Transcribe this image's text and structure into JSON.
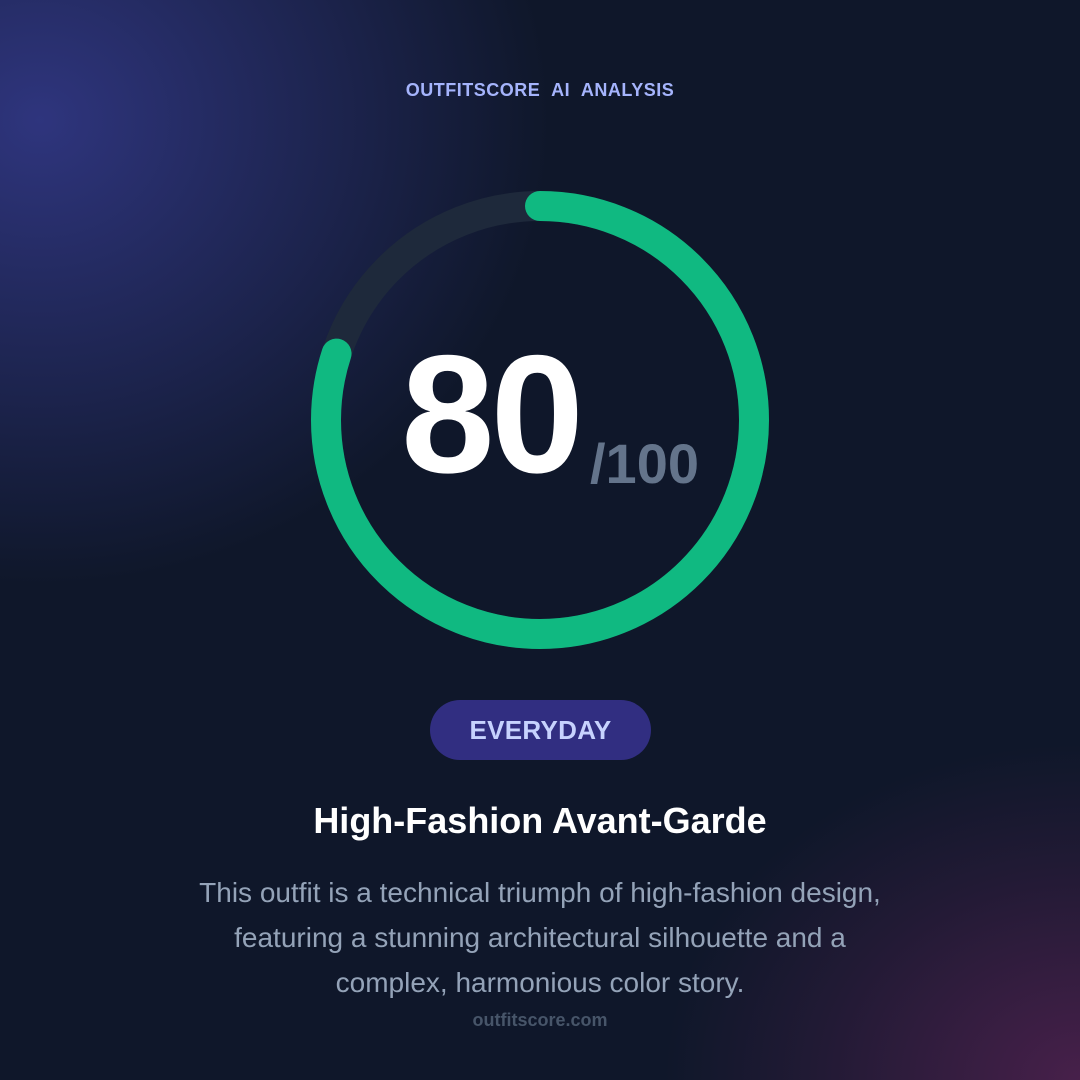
{
  "header": {
    "brand": "OUTFITSCORE AI ANALYSIS"
  },
  "score": {
    "value": "80",
    "max_label": "/100",
    "fraction": 0.8
  },
  "badge": {
    "label": "EVERYDAY"
  },
  "result": {
    "title": "High-Fashion Avant-Garde",
    "description": "This outfit is a technical triumph of high-fashion design, featuring a stunning architectural silhouette and a complex, harmonious color story."
  },
  "footer": {
    "site": "outfitscore.com"
  },
  "colors": {
    "accent": "#10b981",
    "track": "#1e293b",
    "badge_bg": "#312e81",
    "badge_text": "#c7d2fe",
    "brand_text": "#a5b4fc"
  }
}
